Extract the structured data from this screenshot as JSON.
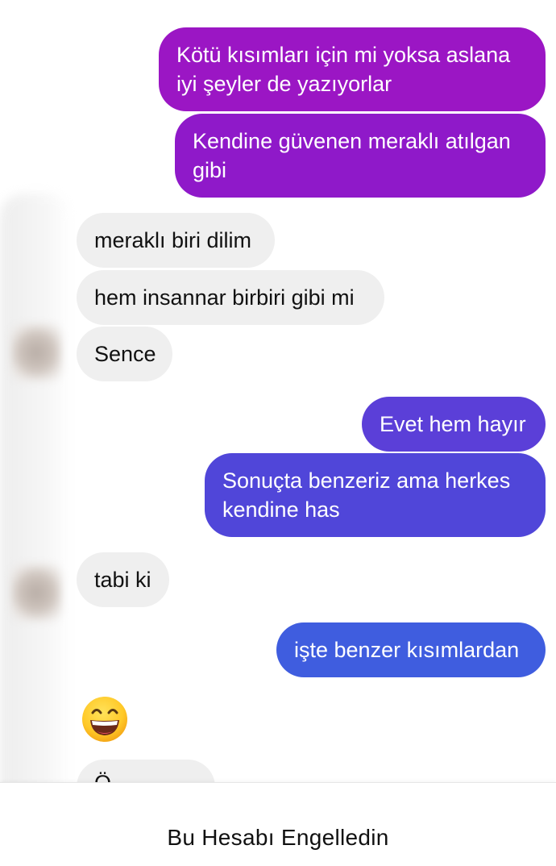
{
  "conversation": {
    "messages": [
      {
        "direction": "out",
        "text": "Kötü kısımları için mi yoksa aslana\niyi şeyler de yazıyorlar",
        "color": "#9b16c4"
      },
      {
        "direction": "out",
        "text": "Kendine güvenen meraklı atılgan\ngibi",
        "color": "#8f19c9"
      },
      {
        "direction": "in",
        "text": "meraklı biri dilim"
      },
      {
        "direction": "in",
        "text": "hem insannar birbiri gibi mi"
      },
      {
        "direction": "in",
        "text": "Sence"
      },
      {
        "direction": "out",
        "text": "Evet hem hayır",
        "color": "#5b3fd8"
      },
      {
        "direction": "out",
        "text": "Sonuçta benzeriz ama herkes\nkendine has",
        "color": "#5046d9"
      },
      {
        "direction": "in",
        "text": "tabi ki"
      },
      {
        "direction": "out",
        "text": "işte benzer kısımlardan",
        "color": "#3f5ddf"
      },
      {
        "direction": "in",
        "emoji": "grinning-face-with-smiling-eyes"
      },
      {
        "direction": "in",
        "text": "Ö..."
      }
    ]
  },
  "footer": {
    "blocked_notice": "Bu Hesabı Engelledin"
  },
  "colors": {
    "incoming_bubble": "#efefef",
    "incoming_text": "#111111",
    "outgoing_text": "#ffffff"
  }
}
